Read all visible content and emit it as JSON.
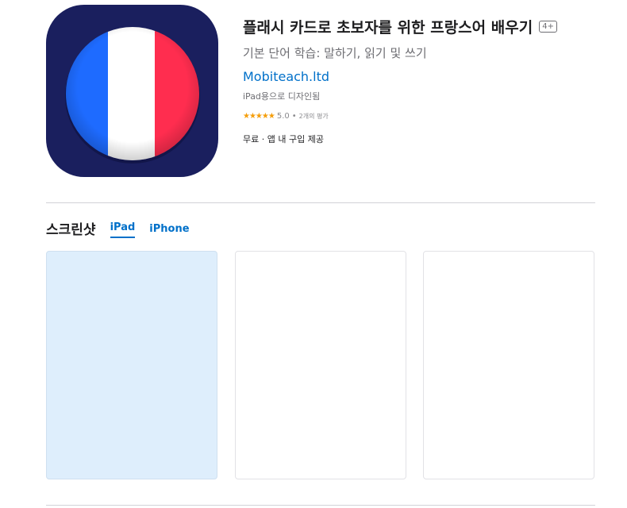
{
  "app": {
    "title": "플래시 카드로 초보자를 위한 프랑스어 배우기",
    "age_rating": "4+",
    "subtitle": "기본 단어 학습: 말하기, 읽기 및 쓰기",
    "developer": "Mobiteach.ltd",
    "designed_for": "iPad용으로 디자인됨",
    "stars": "★★★★★",
    "rating": "5.0",
    "rating_sep": "•",
    "rating_count": "2개의 평가",
    "price": "무료 · 앱 내 구입 제공",
    "icon_colors": {
      "background": "#1a1f5e",
      "blue": "#1e6bff",
      "white": "#ffffff",
      "red": "#ff2d4f"
    }
  },
  "screenshots": {
    "title": "스크린샷",
    "tabs": [
      {
        "label": "iPad"
      },
      {
        "label": "iPhone"
      }
    ]
  }
}
